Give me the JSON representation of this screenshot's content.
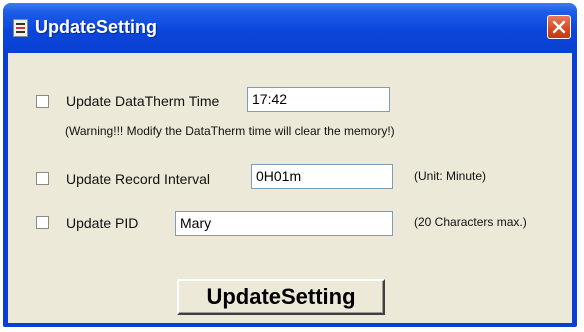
{
  "window": {
    "title": "UpdateSetting",
    "app_icon": "app-window-icon",
    "close_icon": "close-icon"
  },
  "colors": {
    "titlebar": "#0b46dc",
    "client_background": "#ece9d8",
    "close_button": "#d6491f"
  },
  "datatherm_time": {
    "label": "Update DataTherm Time",
    "value": "17:42",
    "checked": false,
    "warning": "(Warning!!!   Modify the DataTherm time will clear the memory!)"
  },
  "record_interval": {
    "label": "Update Record Interval",
    "value": "0H01m",
    "checked": false,
    "unit_note": "(Unit: Minute)"
  },
  "pid": {
    "label": "Update PID",
    "value": "Mary",
    "checked": false,
    "max_note": "(20 Characters max.)"
  },
  "actions": {
    "update_button_label": "UpdateSetting"
  }
}
